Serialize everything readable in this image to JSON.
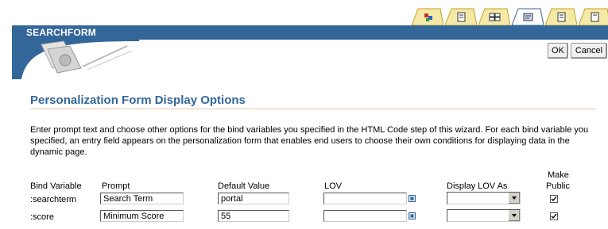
{
  "header": {
    "title": "SEARCHFORM"
  },
  "tabs": [
    {
      "name": "tab-layout",
      "icon": "layout-icon",
      "color": "#c83030"
    },
    {
      "name": "tab-sql",
      "icon": "document-icon",
      "color": "#333333"
    },
    {
      "name": "tab-parameters",
      "icon": "form-fields-icon",
      "color": "#333333"
    },
    {
      "name": "tab-form-display",
      "icon": "form-display-icon",
      "color": "#333333",
      "active": true
    },
    {
      "name": "tab-options",
      "icon": "document-icon",
      "color": "#333333"
    },
    {
      "name": "tab-finish",
      "icon": "document-icon",
      "color": "#333333"
    }
  ],
  "buttons": {
    "ok": "OK",
    "cancel": "Cancel"
  },
  "section": {
    "title": "Personalization Form Display Options",
    "instructions": "Enter prompt text and choose other options for the bind variables you specified in the HTML Code step of this wizard. For each bind variable you specified, an entry field appears on the personalization form that enables end users to choose their own conditions for displaying data in the dynamic page."
  },
  "table": {
    "headers": {
      "bind_variable": "Bind Variable",
      "prompt": "Prompt",
      "default_value": "Default Value",
      "lov": "LOV",
      "display_lov_as": "Display LOV As",
      "make_public_1": "Make",
      "make_public_2": "Public"
    },
    "rows": [
      {
        "bind_variable": ":searchterm",
        "prompt": "Search Term",
        "default_value": "portal",
        "lov": "",
        "display_lov_as": "",
        "make_public": true
      },
      {
        "bind_variable": ":score",
        "prompt": "Minimum Score",
        "default_value": "55",
        "lov": "",
        "display_lov_as": "",
        "make_public": true
      }
    ]
  },
  "colors": {
    "brand": "#336699",
    "accent_rule": "#e8c6a8",
    "tab_fill": "#f5e9a8",
    "tab_border": "#c8a020"
  }
}
